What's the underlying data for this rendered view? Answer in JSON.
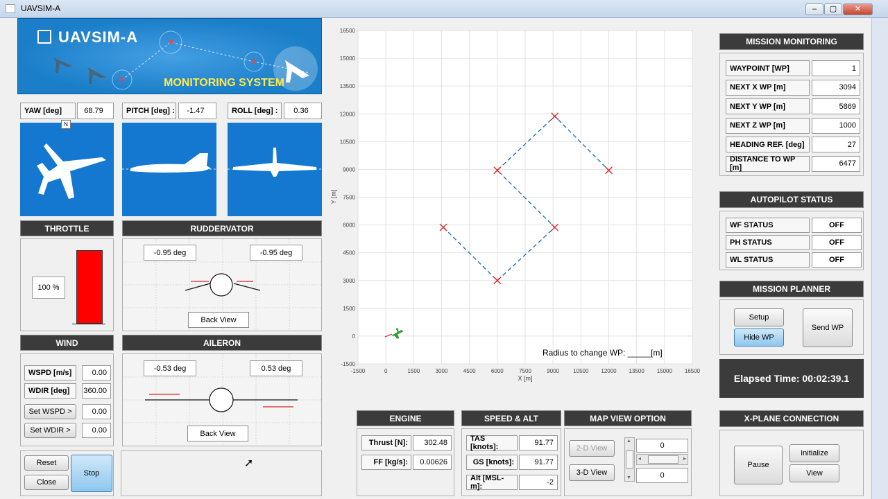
{
  "window": {
    "title": "UAVSIM-A",
    "btn_min": "–",
    "btn_max": "▢",
    "btn_close": "✕"
  },
  "banner": {
    "brand": "UAVSIM-A",
    "subtitle": "MONITORING SYSTEM",
    "bg_color": "#1a7ec8"
  },
  "attitude": {
    "yaw_label": "YAW  [deg]",
    "yaw_value": "68.79",
    "pitch_label": "PITCH  [deg] :",
    "pitch_value": "-1.47",
    "roll_label": "ROLL  [deg] :",
    "roll_value": "0.36",
    "north_marker": "N"
  },
  "throttle": {
    "header": "THROTTLE",
    "value": "100 %",
    "level": 1.0,
    "bar_color": "#ff0000"
  },
  "ruddervator": {
    "header": "RUDDERVATOR",
    "left": "-0.95 deg",
    "right": "-0.95 deg",
    "back_view": "Back View"
  },
  "aileron": {
    "header": "AILERON",
    "left": "-0.53 deg",
    "right": "0.53 deg",
    "back_view": "Back View"
  },
  "wind": {
    "header": "WIND",
    "wspd_label": "WSPD [m/s]",
    "wspd_value": "0.00",
    "wdir_label": "WDIR [deg]",
    "wdir_value": "360.00",
    "set_wspd": "Set WSPD >",
    "set_wspd_value": "0.00",
    "set_wdir": "Set WDIR >",
    "set_wdir_value": "0.00"
  },
  "controls": {
    "reset": "Reset",
    "close": "Close",
    "stop": "Stop"
  },
  "map": {
    "xlabel": "X [m]",
    "ylabel": "Y [m]",
    "xticks": [
      "-1500",
      "0",
      "1500",
      "3000",
      "4500",
      "6000",
      "7500",
      "9000",
      "10500",
      "12000",
      "13500",
      "15000",
      "16500"
    ],
    "yticks": [
      "16500",
      "15000",
      "13500",
      "12000",
      "10500",
      "9000",
      "7500",
      "6000",
      "4500",
      "3000",
      "1500",
      "0",
      "-1500"
    ],
    "radius_note": "Radius to change WP: _____[m]"
  },
  "chart_data": {
    "type": "line",
    "xlim": [
      -1500,
      16500
    ],
    "ylim": [
      -1500,
      16500
    ],
    "xlabel": "X [m]",
    "ylabel": "Y [m]",
    "grid": true,
    "series": [
      {
        "line_color": "#1f77b4",
        "points": [
          [
            3094,
            5869
          ],
          [
            6000,
            3000
          ],
          [
            9094,
            5869
          ],
          [
            6000,
            8950
          ],
          [
            9094,
            11869
          ],
          [
            12000,
            8950
          ]
        ]
      }
    ],
    "waypoints": [
      [
        3094,
        5869
      ],
      [
        6000,
        3000
      ],
      [
        9094,
        5869
      ],
      [
        6000,
        8950
      ],
      [
        9094,
        11869
      ],
      [
        12000,
        8950
      ]
    ],
    "aircraft": [
      550,
      180
    ]
  },
  "engine": {
    "header": "ENGINE",
    "thrust_label": "Thrust [N]:",
    "thrust_value": "302.48",
    "ff_label": "FF [kg/s]:",
    "ff_value": "0.00626"
  },
  "speed_alt": {
    "header": "SPEED & ALT",
    "tas_label": "TAS [knots]:",
    "tas_value": "91.77",
    "gs_label": "GS [knots]:",
    "gs_value": "91.77",
    "alt_label": "Alt [MSL-m]:",
    "alt_value": "-2"
  },
  "map_view": {
    "header": "MAP VIEW OPTION",
    "view2d": "2-D View",
    "view3d": "3-D View",
    "top_value": "0",
    "bottom_value": "0"
  },
  "mission_monitoring": {
    "header": "MISSION MONITORING",
    "rows": [
      {
        "label": "WAYPOINT [WP]",
        "value": "1"
      },
      {
        "label": "NEXT X WP [m]",
        "value": "3094"
      },
      {
        "label": "NEXT Y WP [m]",
        "value": "5869"
      },
      {
        "label": "NEXT Z WP [m]",
        "value": "1000"
      },
      {
        "label": "HEADING REF. [deg]",
        "value": "27"
      },
      {
        "label": "DISTANCE TO WP [m]",
        "value": "6477"
      }
    ]
  },
  "autopilot": {
    "header": "AUTOPILOT STATUS",
    "rows": [
      {
        "label": "WF STATUS",
        "value": "OFF"
      },
      {
        "label": "PH STATUS",
        "value": "OFF"
      },
      {
        "label": "WL STATUS",
        "value": "OFF"
      }
    ]
  },
  "mission_planner": {
    "header": "MISSION PLANNER",
    "setup": "Setup",
    "hide_wp": "Hide WP",
    "send_wp": "Send WP"
  },
  "elapsed": {
    "text": "Elapsed Time: 00:02:39.1"
  },
  "xplane": {
    "header": "X-PLANE CONNECTION",
    "pause": "Pause",
    "initialize": "Initialize",
    "view": "View"
  }
}
